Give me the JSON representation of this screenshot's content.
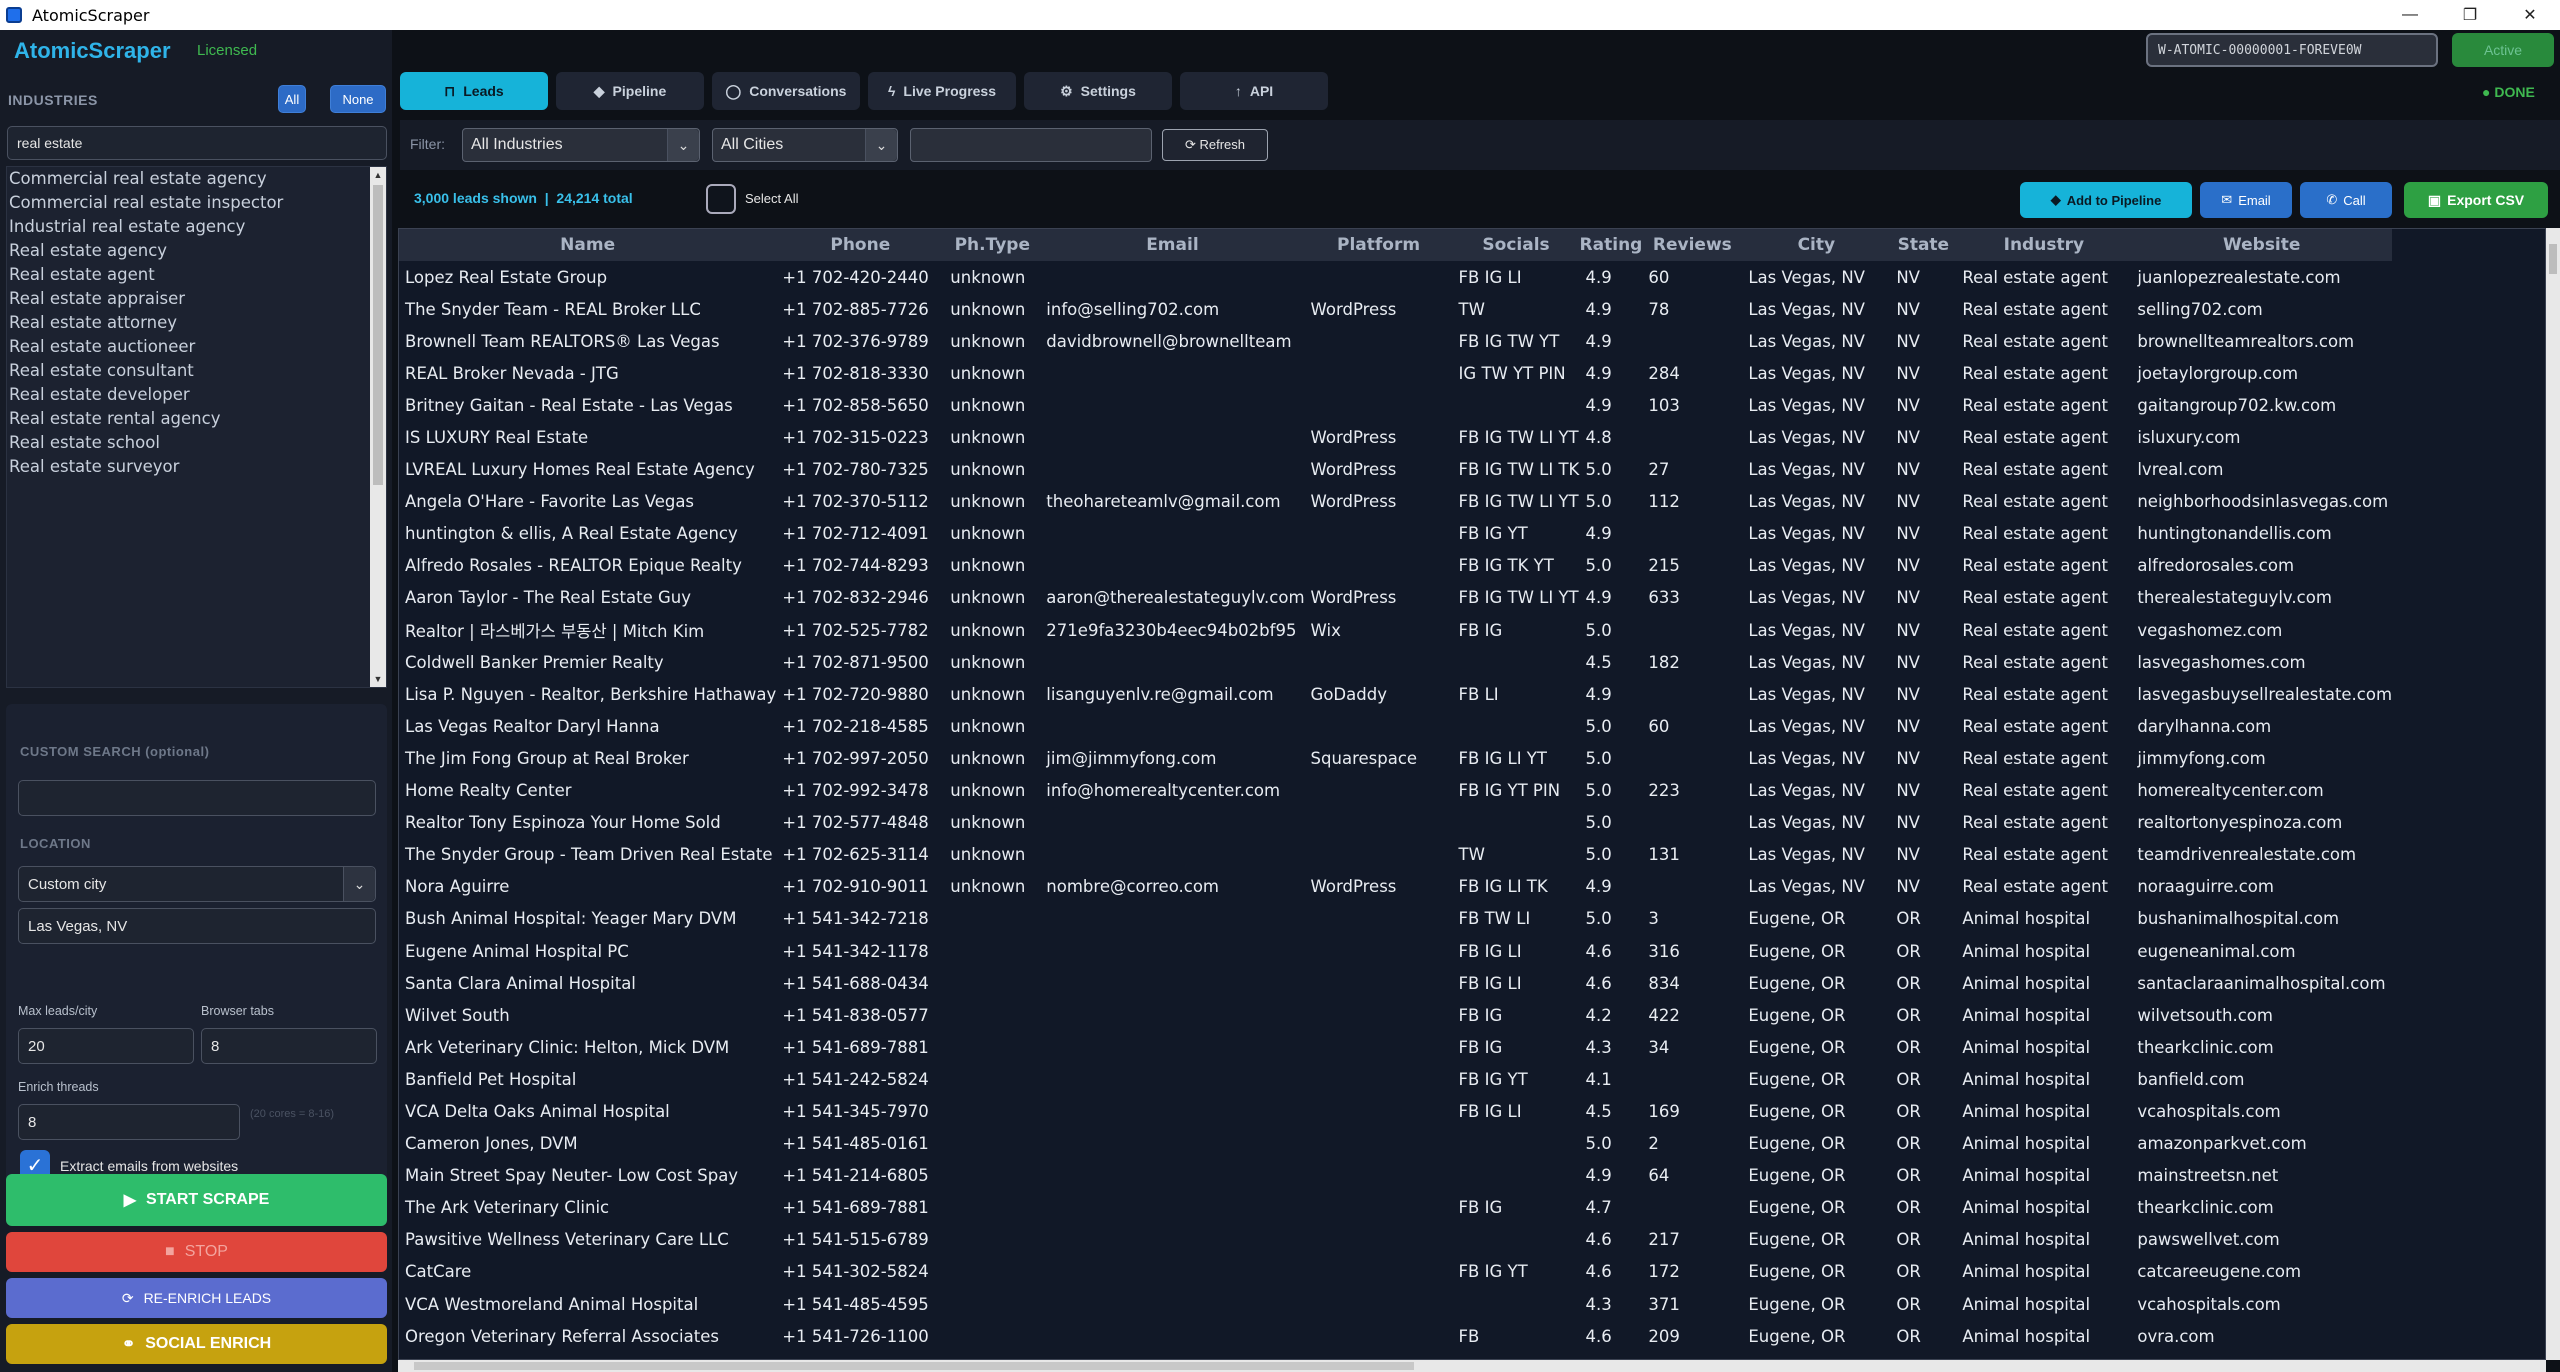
{
  "window": {
    "title": "AtomicScraper",
    "min": "—",
    "max": "❐",
    "close": "✕"
  },
  "sidebar": {
    "brand": "AtomicScraper",
    "license_status": "Licensed",
    "industries_title": "INDUSTRIES",
    "all_label": "All",
    "none_label": "None",
    "search_value": "real estate",
    "industries": [
      "Commercial real estate agency",
      "Commercial real estate inspector",
      "Industrial real estate agency",
      "Real estate agency",
      "Real estate agent",
      "Real estate appraiser",
      "Real estate attorney",
      "Real estate auctioneer",
      "Real estate consultant",
      "Real estate developer",
      "Real estate rental agency",
      "Real estate school",
      "Real estate surveyor"
    ],
    "custom_search_title": "CUSTOM SEARCH (optional)",
    "custom_search_value": "",
    "location_title": "LOCATION",
    "location_mode": "Custom city",
    "location_value": "Las Vegas, NV",
    "max_leads_label": "Max leads/city",
    "max_leads_value": "20",
    "browser_tabs_label": "Browser tabs",
    "browser_tabs_value": "8",
    "enrich_threads_label": "Enrich threads",
    "enrich_threads_value": "8",
    "enrich_hint": "(20 cores = 8-16)",
    "extract_emails_label": "Extract emails from websites",
    "extract_emails_checked": true,
    "start_label": "START SCRAPE",
    "stop_label": "STOP",
    "reenrich_label": "RE-ENRICH LEADS",
    "social_label": "SOCIAL ENRICH"
  },
  "tabs": [
    {
      "label": "Leads",
      "icon": "leads-icon",
      "glyph": "⊓"
    },
    {
      "label": "Pipeline",
      "icon": "pipeline-icon",
      "glyph": "◆"
    },
    {
      "label": "Conversations",
      "icon": "conversations-icon",
      "glyph": "◯"
    },
    {
      "label": "Live Progress",
      "icon": "bolt-icon",
      "glyph": "ϟ"
    },
    {
      "label": "Settings",
      "icon": "gear-icon",
      "glyph": "⚙"
    },
    {
      "label": "API",
      "icon": "api-icon",
      "glyph": "↑"
    }
  ],
  "header": {
    "license_key": "W-ATOMIC-00000001-FOREVE0W",
    "active_label": "Active",
    "status": "● DONE"
  },
  "filter": {
    "label": "Filter:",
    "industry": "All Industries",
    "city": "All Cities",
    "search_value": "",
    "refresh_label": "⟳ Refresh"
  },
  "stats": {
    "summary": "3,000 leads shown  |  24,214 total",
    "select_all": "Select All",
    "add_pipeline": "Add to Pipeline",
    "email": "Email",
    "call": "Call",
    "export": "Export CSV"
  },
  "colors": {
    "accent": "#16b3d9",
    "start": "#2ebd6b",
    "stop": "#e0463c",
    "reenrich": "#5b6ccf",
    "social": "#c6a20f",
    "export": "#2ea043",
    "licensed": "#3fb950"
  },
  "table": {
    "columns": [
      "Name",
      "Phone",
      "Ph.Type",
      "Email",
      "Platform",
      "Socials",
      "Rating",
      "Reviews",
      "City",
      "State",
      "Industry",
      "Website"
    ],
    "rows": [
      [
        "Lopez Real Estate Group",
        "+1 702-420-2440",
        "unknown",
        "",
        "",
        "FB IG LI",
        "4.9",
        "60",
        "Las Vegas, NV",
        "NV",
        "Real estate agent",
        "juanlopezrealestate.com"
      ],
      [
        "The Snyder Team - REAL Broker LLC",
        "+1 702-885-7726",
        "unknown",
        "info@selling702.com",
        "WordPress",
        "TW",
        "4.9",
        "78",
        "Las Vegas, NV",
        "NV",
        "Real estate agent",
        "selling702.com"
      ],
      [
        "Brownell Team REALTORS® Las Vegas",
        "+1 702-376-9789",
        "unknown",
        "davidbrownell@brownellteam",
        "",
        "FB IG TW YT",
        "4.9",
        "",
        "Las Vegas, NV",
        "NV",
        "Real estate agent",
        "brownellteamrealtors.com"
      ],
      [
        "REAL Broker Nevada - JTG",
        "+1 702-818-3330",
        "unknown",
        "",
        "",
        "IG TW YT PIN",
        "4.9",
        "284",
        "Las Vegas, NV",
        "NV",
        "Real estate agent",
        "joetaylorgroup.com"
      ],
      [
        "Britney Gaitan - Real Estate - Las Vegas",
        "+1 702-858-5650",
        "unknown",
        "",
        "",
        "",
        "4.9",
        "103",
        "Las Vegas, NV",
        "NV",
        "Real estate agent",
        "gaitangroup702.kw.com"
      ],
      [
        "IS LUXURY Real Estate",
        "+1 702-315-0223",
        "unknown",
        "",
        "WordPress",
        "FB IG TW LI YT",
        "4.8",
        "",
        "Las Vegas, NV",
        "NV",
        "Real estate agent",
        "isluxury.com"
      ],
      [
        "LVREAL Luxury Homes Real Estate Agency",
        "+1 702-780-7325",
        "unknown",
        "",
        "WordPress",
        "FB IG TW LI TK",
        "5.0",
        "27",
        "Las Vegas, NV",
        "NV",
        "Real estate agent",
        "lvreal.com"
      ],
      [
        "Angela O'Hare - Favorite Las Vegas",
        "+1 702-370-5112",
        "unknown",
        "theohareteamlv@gmail.com",
        "WordPress",
        "FB IG TW LI YT",
        "5.0",
        "112",
        "Las Vegas, NV",
        "NV",
        "Real estate agent",
        "neighborhoodsinlasvegas.com"
      ],
      [
        "huntington & ellis, A Real Estate Agency",
        "+1 702-712-4091",
        "unknown",
        "",
        "",
        "FB IG YT",
        "4.9",
        "",
        "Las Vegas, NV",
        "NV",
        "Real estate agent",
        "huntingtonandellis.com"
      ],
      [
        "Alfredo Rosales - REALTOR Epique Realty",
        "+1 702-744-8293",
        "unknown",
        "",
        "",
        "FB IG TK YT",
        "5.0",
        "215",
        "Las Vegas, NV",
        "NV",
        "Real estate agent",
        "alfredorosales.com"
      ],
      [
        "Aaron Taylor - The Real Estate Guy",
        "+1 702-832-2946",
        "unknown",
        "aaron@therealestateguylv.com",
        "WordPress",
        "FB IG TW LI YT",
        "4.9",
        "633",
        "Las Vegas, NV",
        "NV",
        "Real estate agent",
        "therealestateguylv.com"
      ],
      [
        "Realtor | 라스베가스 부동산 | Mitch Kim",
        "+1 702-525-7782",
        "unknown",
        "271e9fa3230b4eec94b02bf95",
        "Wix",
        "FB IG",
        "5.0",
        "",
        "Las Vegas, NV",
        "NV",
        "Real estate agent",
        "vegashomez.com"
      ],
      [
        "Coldwell Banker Premier Realty",
        "+1 702-871-9500",
        "unknown",
        "",
        "",
        "",
        "4.5",
        "182",
        "Las Vegas, NV",
        "NV",
        "Real estate agent",
        "lasvegashomes.com"
      ],
      [
        "Lisa P. Nguyen - Realtor, Berkshire Hathaway",
        "+1 702-720-9880",
        "unknown",
        "lisanguyenlv.re@gmail.com",
        "GoDaddy",
        "FB LI",
        "4.9",
        "",
        "Las Vegas, NV",
        "NV",
        "Real estate agent",
        "lasvegasbuysellrealestate.com"
      ],
      [
        "Las Vegas Realtor Daryl Hanna",
        "+1 702-218-4585",
        "unknown",
        "",
        "",
        "",
        "5.0",
        "60",
        "Las Vegas, NV",
        "NV",
        "Real estate agent",
        "darylhanna.com"
      ],
      [
        "The Jim Fong Group at Real Broker",
        "+1 702-997-2050",
        "unknown",
        "jim@jimmyfong.com",
        "Squarespace",
        "FB IG LI YT",
        "5.0",
        "",
        "Las Vegas, NV",
        "NV",
        "Real estate agent",
        "jimmyfong.com"
      ],
      [
        "Home Realty Center",
        "+1 702-992-3478",
        "unknown",
        "info@homerealtycenter.com",
        "",
        "FB IG YT PIN",
        "5.0",
        "223",
        "Las Vegas, NV",
        "NV",
        "Real estate agent",
        "homerealtycenter.com"
      ],
      [
        "Realtor Tony Espinoza Your Home Sold",
        "+1 702-577-4848",
        "unknown",
        "",
        "",
        "",
        "5.0",
        "",
        "Las Vegas, NV",
        "NV",
        "Real estate agent",
        "realtortonyespinoza.com"
      ],
      [
        "The Snyder Group - Team Driven Real Estate",
        "+1 702-625-3114",
        "unknown",
        "",
        "",
        "TW",
        "5.0",
        "131",
        "Las Vegas, NV",
        "NV",
        "Real estate agent",
        "teamdrivenrealestate.com"
      ],
      [
        "Nora Aguirre",
        "+1 702-910-9011",
        "unknown",
        "nombre@correo.com",
        "WordPress",
        "FB IG LI TK",
        "4.9",
        "",
        "Las Vegas, NV",
        "NV",
        "Real estate agent",
        "noraaguirre.com"
      ],
      [
        "Bush Animal Hospital: Yeager Mary DVM",
        "+1 541-342-7218",
        "",
        "",
        "",
        "FB TW LI",
        "5.0",
        "3",
        "Eugene, OR",
        "OR",
        "Animal hospital",
        "bushanimalhospital.com"
      ],
      [
        "Eugene Animal Hospital PC",
        "+1 541-342-1178",
        "",
        "",
        "",
        "FB IG LI",
        "4.6",
        "316",
        "Eugene, OR",
        "OR",
        "Animal hospital",
        "eugeneanimal.com"
      ],
      [
        "Santa Clara Animal Hospital",
        "+1 541-688-0434",
        "",
        "",
        "",
        "FB IG LI",
        "4.6",
        "834",
        "Eugene, OR",
        "OR",
        "Animal hospital",
        "santaclaraanimalhospital.com"
      ],
      [
        "Wilvet South",
        "+1 541-838-0577",
        "",
        "",
        "",
        "FB IG",
        "4.2",
        "422",
        "Eugene, OR",
        "OR",
        "Animal hospital",
        "wilvetsouth.com"
      ],
      [
        "Ark Veterinary Clinic: Helton, Mick DVM",
        "+1 541-689-7881",
        "",
        "",
        "",
        "FB IG",
        "4.3",
        "34",
        "Eugene, OR",
        "OR",
        "Animal hospital",
        "thearkclinic.com"
      ],
      [
        "Banfield Pet Hospital",
        "+1 541-242-5824",
        "",
        "",
        "",
        "FB IG YT",
        "4.1",
        "",
        "Eugene, OR",
        "OR",
        "Animal hospital",
        "banfield.com"
      ],
      [
        "VCA Delta Oaks Animal Hospital",
        "+1 541-345-7970",
        "",
        "",
        "",
        "FB IG LI",
        "4.5",
        "169",
        "Eugene, OR",
        "OR",
        "Animal hospital",
        "vcahospitals.com"
      ],
      [
        "Cameron Jones, DVM",
        "+1 541-485-0161",
        "",
        "",
        "",
        "",
        "5.0",
        "2",
        "Eugene, OR",
        "OR",
        "Animal hospital",
        "amazonparkvet.com"
      ],
      [
        "Main Street Spay Neuter- Low Cost Spay",
        "+1 541-214-6805",
        "",
        "",
        "",
        "",
        "4.9",
        "64",
        "Eugene, OR",
        "OR",
        "Animal hospital",
        "mainstreetsn.net"
      ],
      [
        "The Ark Veterinary Clinic",
        "+1 541-689-7881",
        "",
        "",
        "",
        "FB IG",
        "4.7",
        "",
        "Eugene, OR",
        "OR",
        "Animal hospital",
        "thearkclinic.com"
      ],
      [
        "Pawsitive Wellness Veterinary Care LLC",
        "+1 541-515-6789",
        "",
        "",
        "",
        "",
        "4.6",
        "217",
        "Eugene, OR",
        "OR",
        "Animal hospital",
        "pawswellvet.com"
      ],
      [
        "CatCare",
        "+1 541-302-5824",
        "",
        "",
        "",
        "FB IG YT",
        "4.6",
        "172",
        "Eugene, OR",
        "OR",
        "Animal hospital",
        "catcareeugene.com"
      ],
      [
        "VCA Westmoreland Animal Hospital",
        "+1 541-485-4595",
        "",
        "",
        "",
        "",
        "4.3",
        "371",
        "Eugene, OR",
        "OR",
        "Animal hospital",
        "vcahospitals.com"
      ],
      [
        "Oregon Veterinary Referral Associates",
        "+1 541-726-1100",
        "",
        "",
        "",
        "FB",
        "4.6",
        "209",
        "Eugene, OR",
        "OR",
        "Animal hospital",
        "ovra.com"
      ]
    ]
  }
}
